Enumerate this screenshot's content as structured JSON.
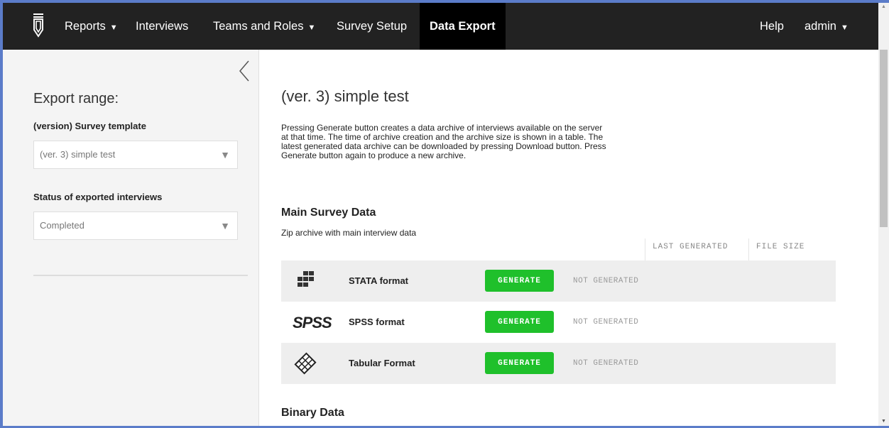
{
  "nav": {
    "items": [
      {
        "label": "Reports",
        "has_caret": true
      },
      {
        "label": "Interviews",
        "has_caret": false
      },
      {
        "label": "Teams and Roles",
        "has_caret": true
      },
      {
        "label": "Survey Setup",
        "has_caret": false
      },
      {
        "label": "Data Export",
        "has_caret": false,
        "active": true
      }
    ],
    "help": "Help",
    "user": "admin",
    "caret": "▼"
  },
  "sidebar": {
    "title": "Export range:",
    "template_label": "(version) Survey template",
    "template_value": "(ver. 3) simple test",
    "status_label": "Status of exported interviews",
    "status_value": "Completed",
    "select_arrow": "▼"
  },
  "main": {
    "title": "(ver. 3) simple test",
    "description": "Pressing Generate button creates a data archive of interviews available on the server at that time. The time of archive creation and the archive size is shown in a table. The latest generated data archive can be downloaded by pressing Download button. Press Generate button again to produce a new archive.",
    "main_section": {
      "title": "Main Survey Data",
      "subtitle": "Zip archive with main interview data",
      "col_last_generated": "LAST GENERATED",
      "col_file_size": "FILE SIZE",
      "rows": [
        {
          "icon": "stata-icon",
          "format": "STATA format",
          "button": "GENERATE",
          "status": "NOT GENERATED"
        },
        {
          "icon": "spss-icon",
          "format": "SPSS format",
          "button": "GENERATE",
          "status": "NOT GENERATED",
          "icon_text": "SPSS"
        },
        {
          "icon": "tabular-icon",
          "format": "Tabular Format",
          "button": "GENERATE",
          "status": "NOT GENERATED"
        }
      ]
    },
    "binary_section": {
      "title": "Binary Data"
    }
  },
  "colors": {
    "nav_bg": "#222222",
    "active_nav_bg": "#000000",
    "generate_green": "#1fc02b",
    "sidebar_bg": "#f4f4f4",
    "row_shade": "#eeeeee"
  }
}
